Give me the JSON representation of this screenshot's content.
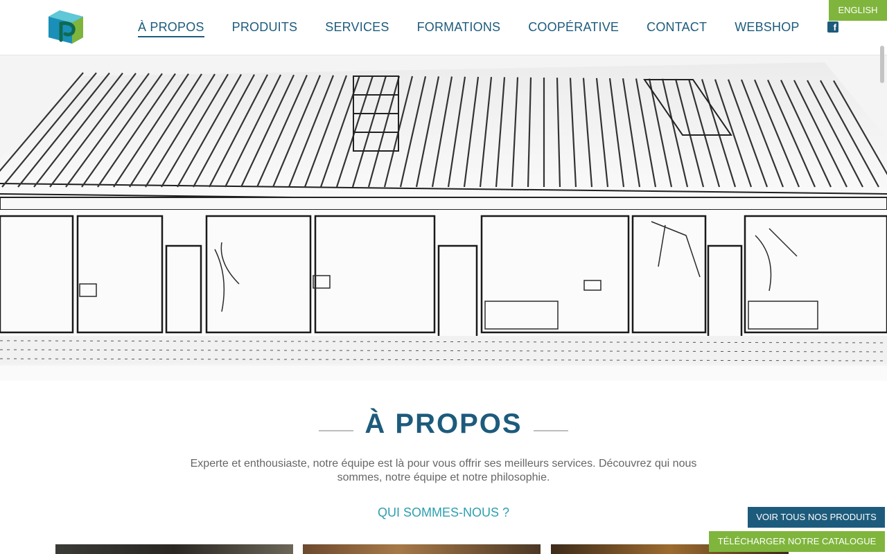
{
  "header": {
    "nav": [
      {
        "label": "À PROPOS",
        "active": true
      },
      {
        "label": "PRODUITS"
      },
      {
        "label": "SERVICES"
      },
      {
        "label": "FORMATIONS"
      },
      {
        "label": "COOPÉRATIVE"
      },
      {
        "label": "CONTACT"
      },
      {
        "label": "WEBSHOP"
      }
    ],
    "language": "ENGLISH",
    "social_icon": "facebook-icon"
  },
  "hero": {
    "image": "building-sketch"
  },
  "about": {
    "title": "À PROPOS",
    "intro": "Experte et enthousiaste, notre équipe est là pour vous offrir ses meilleurs services. Découvrez qui nous sommes, notre équipe et notre philosophie.",
    "subtitle": "QUI SOMMES-NOUS ?"
  },
  "cta": {
    "products": "VOIR TOUS NOS PRODUITS",
    "catalogue": "TÉLÉCHARGER NOTRE CATALOGUE"
  },
  "colors": {
    "primary": "#1d5b7c",
    "accent": "#7fb53c",
    "teal": "#2c9fb0"
  }
}
